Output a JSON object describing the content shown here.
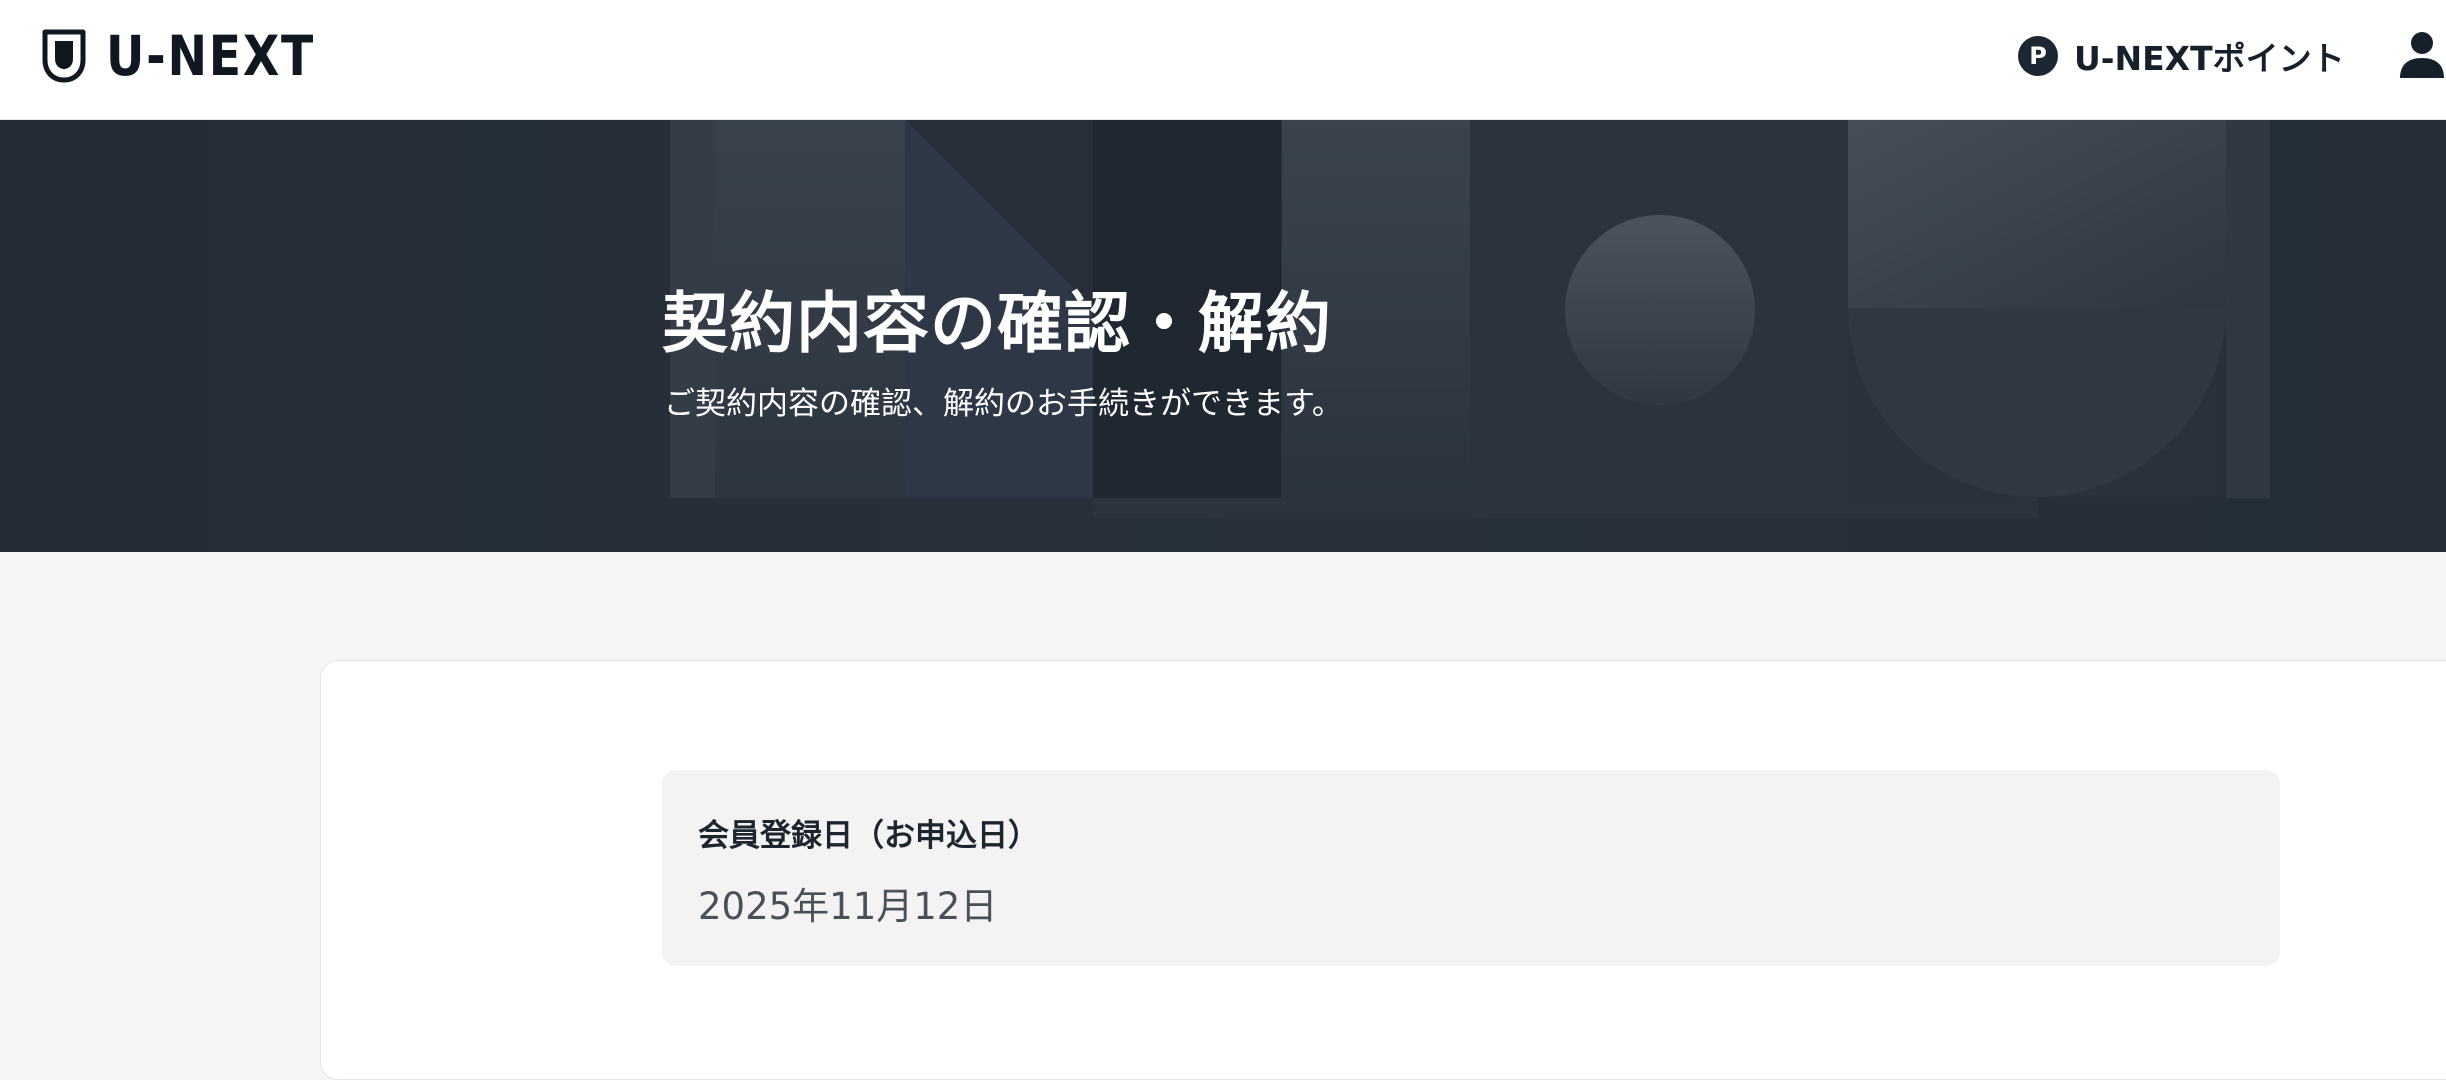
{
  "header": {
    "logo_text": "U-NEXT",
    "points_badge": "P",
    "points_label": "U-NEXTポイント"
  },
  "hero": {
    "title": "契約内容の確認・解約",
    "subtitle": "ご契約内容の確認、解約のお手続きができます。"
  },
  "main": {
    "registration_label": "会員登録日（お申込日）",
    "registration_value": "2025年11月12日"
  },
  "colors": {
    "header_bg": "#ffffff",
    "hero_bg": "#232c37",
    "page_bg": "#f5f6f8",
    "text_dark": "#16202b",
    "info_box_bg": "#f3f3f3"
  },
  "icons": [
    "u-next-shield-logo",
    "points-icon",
    "account-icon"
  ]
}
